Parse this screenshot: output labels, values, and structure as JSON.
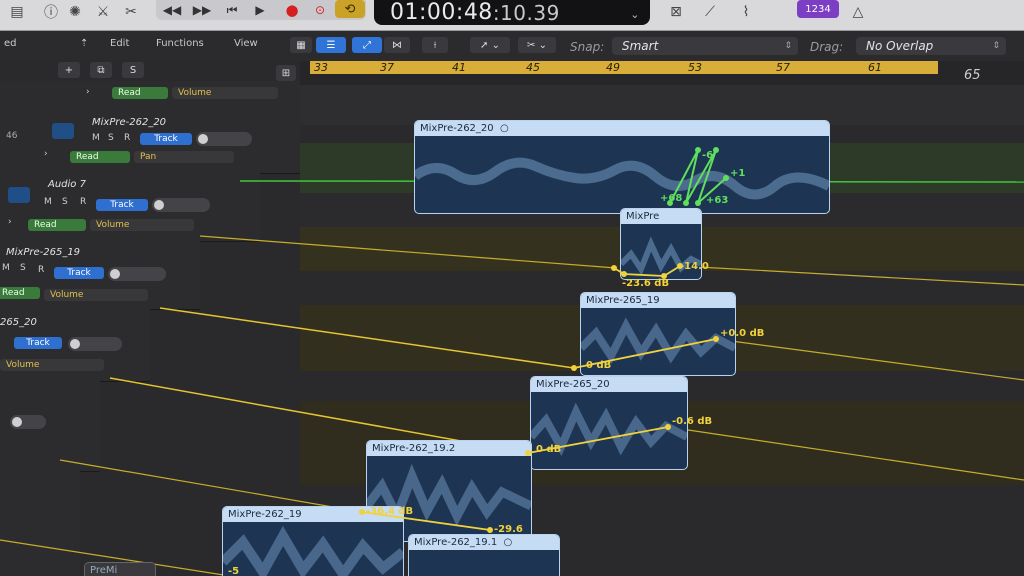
{
  "transport": {
    "timecode_main": "01:00:48",
    "timecode_sub": ":10.39",
    "key_badge": "1234"
  },
  "toolbar": {
    "menus": [
      "Edit",
      "Functions",
      "View"
    ],
    "snap_label": "Snap:",
    "snap_value": "Smart",
    "drag_label": "Drag:",
    "drag_value": "No Overlap"
  },
  "ruler": {
    "bars": [
      "33",
      "37",
      "41",
      "45",
      "49",
      "53",
      "57",
      "61",
      "65"
    ]
  },
  "header_controls": {
    "add_label": "+",
    "solo_label": "S"
  },
  "tracks": [
    {
      "number": "",
      "name": "",
      "read": "Read",
      "param": "Volume"
    },
    {
      "number": "46",
      "name": "MixPre-262_20",
      "m": "M",
      "s": "S",
      "r": "R",
      "btn": "Track",
      "read": "Read",
      "param": "Pan"
    },
    {
      "number": "",
      "name": "Audio 7",
      "m": "M",
      "s": "S",
      "r": "R",
      "btn": "Track",
      "read": "Read",
      "param": "Volume"
    },
    {
      "number": "",
      "name": "MixPre-265_19",
      "m": "M",
      "s": "S",
      "r": "R",
      "btn": "Track",
      "read": "Read",
      "param": "Volume"
    },
    {
      "number": "",
      "name": "265_20",
      "s": "S",
      "r": "R",
      "btn": "Track",
      "param": "Volume"
    }
  ],
  "regions": {
    "r1": "MixPre-262_20",
    "r2": "MixPre",
    "r3": "MixPre-265_19",
    "r4": "MixPre-265_20",
    "r5": "MixPre-262_19.2",
    "r6": "MixPre-262_19",
    "r7": "MixPre-262_19.1",
    "r8": "PreMi"
  },
  "automation_labels": {
    "g1": "-6",
    "g2": "+1",
    "g3": "+68",
    "g4": "+63",
    "y1": "-14.0",
    "y2": "-23.6 dB",
    "y3": "+0.0 dB",
    "y4": "0 dB",
    "y5": "-0.6 dB",
    "y6": "0 dB",
    "y7": "-36.4 dB",
    "y8": "-29.6",
    "y9": "-5"
  },
  "colors": {
    "cycle": "#d8ad3a",
    "region": "#1d3553",
    "region_header": "#c6dcf4",
    "automation_yellow": "#f2d23a",
    "automation_green": "#5ee05e",
    "track_button": "#2e6fd0"
  }
}
